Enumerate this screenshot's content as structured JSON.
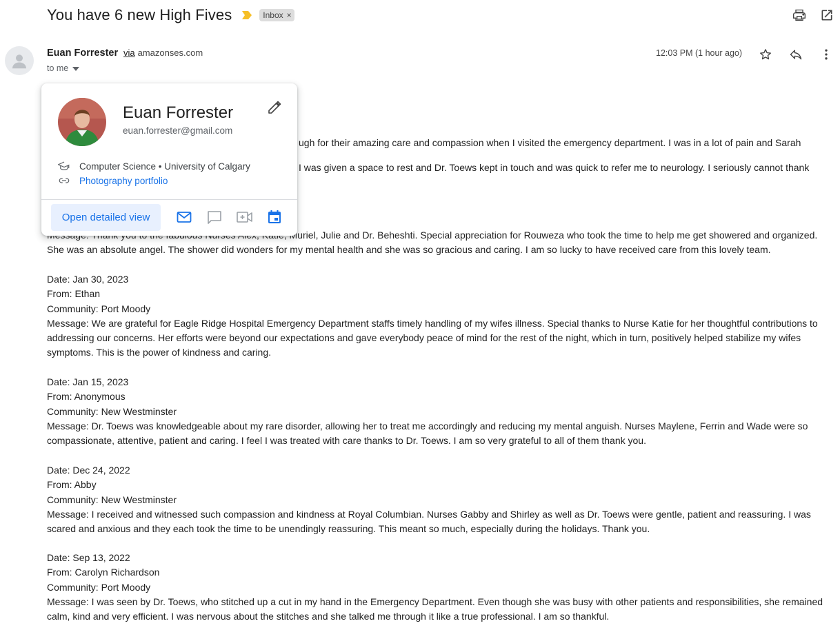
{
  "subject": {
    "title": "You have 6 new High Fives",
    "label": "Inbox",
    "label_remove": "×",
    "importance_color": "#f6bf26"
  },
  "toolbar": {
    "icons": [
      "print-icon",
      "open-in-new-window-icon"
    ]
  },
  "message_header": {
    "sender_name": "Euan Forrester",
    "via_text": "via",
    "via_domain": "amazonses.com",
    "to_text": "to me",
    "time": "12:03 PM (1 hour ago)",
    "actions": [
      "star-icon",
      "reply-icon",
      "more-vert-icon"
    ]
  },
  "hover_card": {
    "name": "Euan Forrester",
    "email": "euan.forrester@gmail.com",
    "education": "Computer Science • University of Calgary",
    "link_text": "Photography portfolio",
    "open_detailed_view": "Open detailed view",
    "actions": [
      "mail-icon",
      "chat-icon",
      "video-call-icon",
      "calendar-icon"
    ],
    "accent_color": "#1a73e8"
  },
  "body": {
    "partial_line_1": "ugh for their amazing care and compassion when I visited the emergency department. I was in a lot of pain and Sarah",
    "partial_line_2": "I was given a space to rest and Dr. Toews kept in touch and was quick to refer me to neurology. I seriously cannot thank",
    "message_1_line_1": "Message: Thank you to the fabulous Nurses Alex, Katie, Muriel, Julie and Dr. Beheshti. Special appreciation for Rouweza who took the time to help me get showered and organized.",
    "message_1_line_2": "She was an absolute angel. The shower did wonders for my mental health and she was so gracious and caring. I am so lucky to have received care from this lovely team.",
    "entries": [
      {
        "date": "Date: Jan 30, 2023",
        "from": "From: Ethan",
        "community": "Community: Port Moody",
        "message": "Message: We are grateful for Eagle Ridge Hospital Emergency Department staffs timely handling of my wifes illness. Special thanks to Nurse Katie for her thoughtful contributions to addressing our concerns. Her efforts were beyond our expectations and gave everybody peace of mind for the rest of the night, which in turn, positively helped stabilize my wifes symptoms. This is the power of kindness and caring."
      },
      {
        "date": "Date: Jan 15, 2023",
        "from": "From: Anonymous",
        "community": "Community: New Westminster",
        "message": "Message: Dr. Toews was knowledgeable about my rare disorder, allowing her to treat me accordingly and reducing my mental anguish. Nurses Maylene, Ferrin and Wade were so compassionate, attentive, patient and caring. I feel I was treated with care thanks to Dr. Toews. I am so very grateful to all of them  thank you."
      },
      {
        "date": "Date: Dec 24, 2022",
        "from": "From: Abby",
        "community": "Community: New Westminster",
        "message": "Message: I received and witnessed such compassion and kindness at Royal Columbian. Nurses Gabby and Shirley as well as Dr. Toews were gentle, patient and reassuring. I was scared and anxious and they each took the time to be unendingly reassuring. This meant so much, especially during the holidays. Thank you."
      },
      {
        "date": "Date: Sep 13, 2022",
        "from": "From: Carolyn Richardson",
        "community": "Community: Port Moody",
        "message": "Message: I was seen by Dr. Toews, who stitched up a cut in my hand in the Emergency Department. Even though she was busy with other patients and responsibilities, she remained calm, kind and very efficient. I was nervous about the stitches and she talked me through it like a true professional. I am so thankful."
      }
    ]
  }
}
